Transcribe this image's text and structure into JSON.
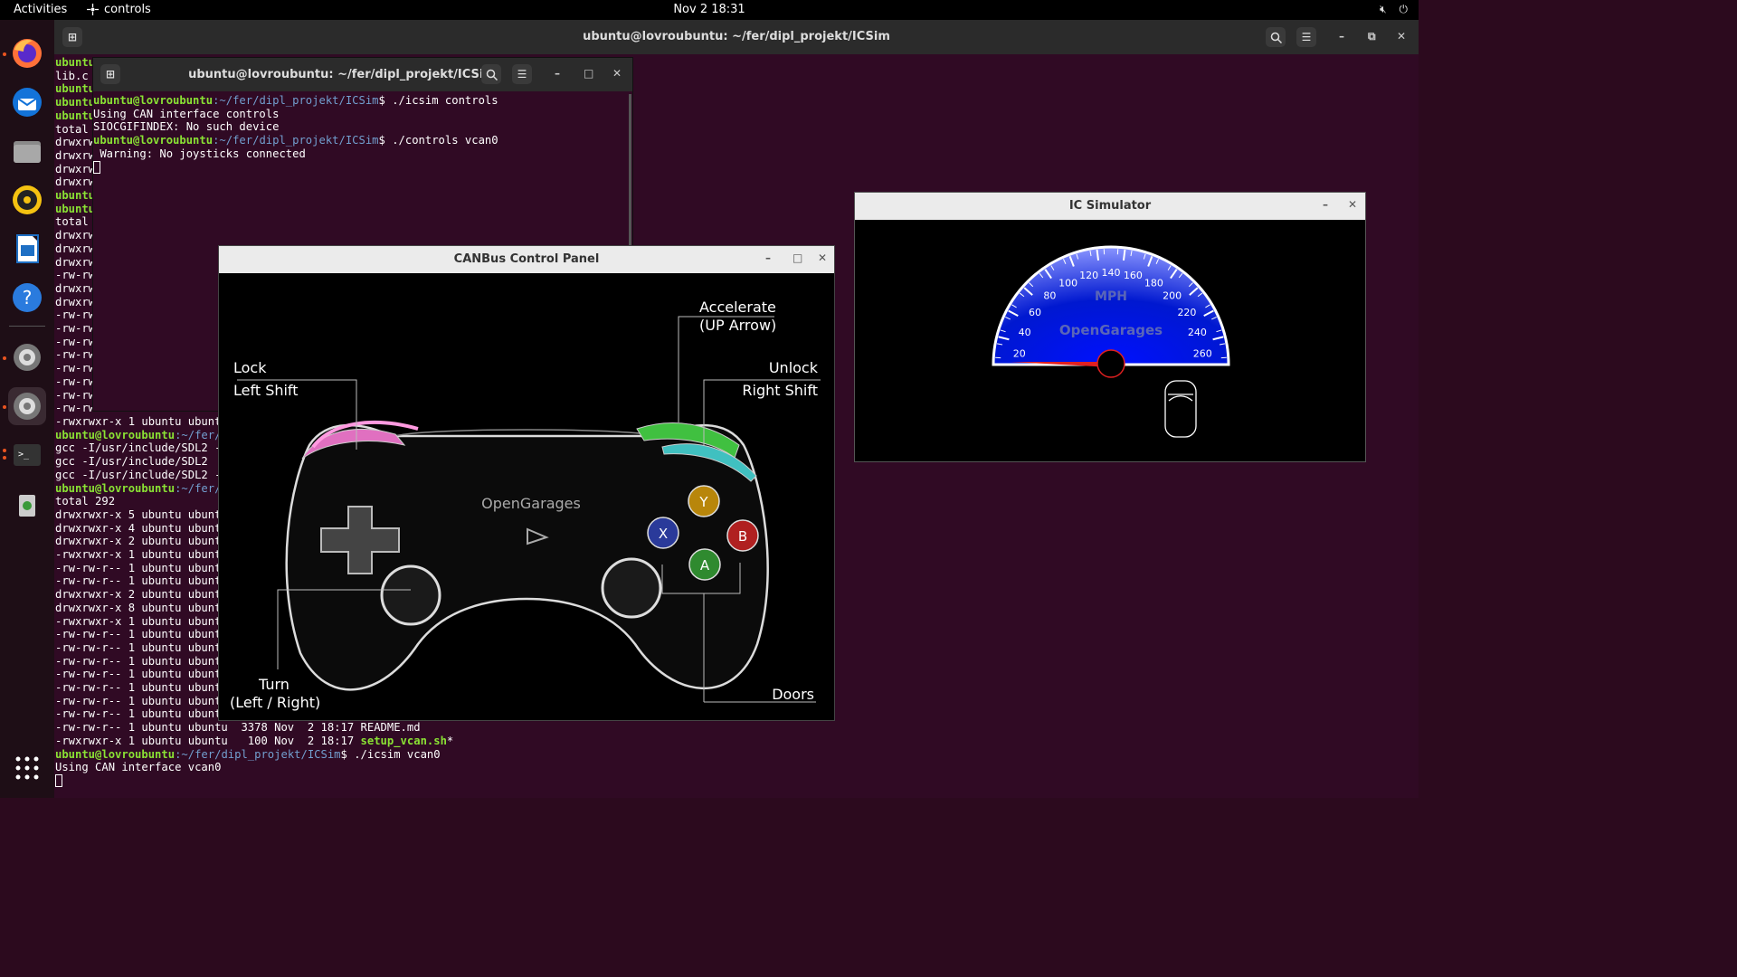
{
  "topbar": {
    "activities": "Activities",
    "app_name": "controls",
    "clock": "Nov 2  18:31"
  },
  "dock": {
    "items": [
      "firefox-icon",
      "thunderbird-icon",
      "files-icon",
      "rhythmbox-icon",
      "writer-icon",
      "help-icon",
      "settings-icon",
      "settings-icon",
      "terminal-icon",
      "trash-icon",
      "show-apps-icon"
    ]
  },
  "big_terminal": {
    "title": "ubuntu@lovroubuntu: ~/fer/dipl_projekt/ICSim",
    "left_column": [
      "ubuntu",
      "lib.c",
      "ubuntu",
      "ubuntu",
      "ubuntu",
      "total",
      "drwxrw",
      "drwxrw",
      "drwxrw",
      "drwxrw",
      "ubuntu",
      "ubuntu",
      "total",
      "drwxrw",
      "drwxrw",
      "drwxrw",
      "-rw-rw",
      "drwxrw",
      "drwxrw",
      "-rw-rw",
      "-rw-rw",
      "-rw-rw",
      "-rw-rw",
      "-rw-rw",
      "-rw-rw",
      "-rw-rw",
      "-rw-rw"
    ],
    "lines": [
      {
        "t": "-rwxrwxr-x 1 ubuntu ubunt"
      },
      {
        "p": "ubuntu@lovroubuntu",
        "d": ":~/fer/",
        "t": ""
      },
      {
        "t": "gcc -I/usr/include/SDL2 -"
      },
      {
        "t": "gcc -I/usr/include/SDL2"
      },
      {
        "t": "gcc -I/usr/include/SDL2 -"
      },
      {
        "p": "ubuntu@lovroubuntu",
        "d": ":~/fer/",
        "t": ""
      },
      {
        "t": "total 292"
      },
      {
        "t": "drwxrwxr-x 5 ubuntu ubunt"
      },
      {
        "t": "drwxrwxr-x 4 ubuntu ubunt"
      },
      {
        "t": "drwxrwxr-x 2 ubuntu ubunt"
      },
      {
        "t": "-rwxrwxr-x 1 ubuntu ubunt"
      },
      {
        "t": "-rw-rw-r-- 1 ubuntu ubunt"
      },
      {
        "t": "-rw-rw-r-- 1 ubuntu ubunt"
      },
      {
        "t": "drwxrwxr-x 2 ubuntu ubunt"
      },
      {
        "t": "drwxrwxr-x 8 ubuntu ubunt"
      },
      {
        "t": "-rwxrwxr-x 1 ubuntu ubunt"
      },
      {
        "t": "-rw-rw-r-- 1 ubuntu ubunt"
      },
      {
        "t": "-rw-rw-r-- 1 ubuntu ubunt"
      },
      {
        "t": "-rw-rw-r-- 1 ubuntu ubunt"
      },
      {
        "t": "-rw-rw-r-- 1 ubuntu ubunt"
      },
      {
        "t": "-rw-rw-r-- 1 ubuntu ubunt"
      },
      {
        "t": "-rw-rw-r-- 1 ubuntu ubunt"
      },
      {
        "t": "-rw-rw-r-- 1 ubuntu ubunt"
      },
      {
        "t": "-rw-rw-r-- 1 ubuntu ubuntu  3378 Nov  2 18:17 README.md"
      },
      {
        "t": "-rwxrwxr-x 1 ubuntu ubuntu   100 Nov  2 18:17 ",
        "g": "setup_vcan.sh",
        "s": "*"
      },
      {
        "p": "ubuntu@lovroubuntu",
        "d": ":~/fer/dipl_projekt/ICSim",
        "t": "$ ./icsim vcan0"
      },
      {
        "t": "Using CAN interface vcan0"
      }
    ]
  },
  "small_terminal": {
    "title": "ubuntu@lovroubuntu: ~/fer/dipl_projekt/ICSim",
    "lines": [
      {
        "p": "ubuntu@lovroubuntu",
        "d": ":~/fer/dipl_projekt/ICSim",
        "t": "$ ./icsim controls"
      },
      {
        "t": "Using CAN interface controls"
      },
      {
        "t": "SIOCGIFINDEX: No such device"
      },
      {
        "p": "ubuntu@lovroubuntu",
        "d": ":~/fer/dipl_projekt/ICSim",
        "t": "$ ./controls vcan0"
      },
      {
        "t": " Warning: No joysticks connected"
      }
    ]
  },
  "canbus": {
    "title": "CANBus Control Panel",
    "accelerate": "Accelerate",
    "accelerate_key": "(UP Arrow)",
    "lock": "Lock",
    "lock_key": "Left Shift",
    "unlock": "Unlock",
    "unlock_key": "Right Shift",
    "turn": "Turn",
    "turn_key": "(Left / Right)",
    "doors": "Doors",
    "brand": "OpenGarages",
    "buttons": {
      "y": "Y",
      "x": "X",
      "b": "B",
      "a": "A"
    }
  },
  "icsim": {
    "title": "IC Simulator",
    "unit": "MPH",
    "brand": "OpenGarages",
    "ticks": [
      "20",
      "40",
      "60",
      "80",
      "100",
      "120",
      "140",
      "160",
      "180",
      "200",
      "220",
      "240",
      "260"
    ],
    "speed": 0
  }
}
